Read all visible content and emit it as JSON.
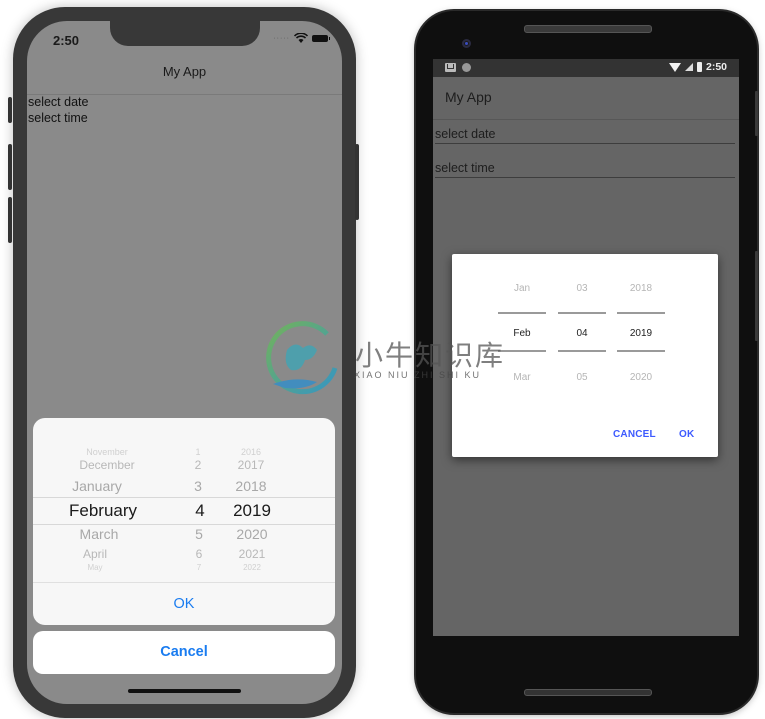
{
  "ios": {
    "status_time": "2:50",
    "status_dots": "·····",
    "nav_title": "My App",
    "fields": [
      "select date",
      "select time"
    ],
    "picker": {
      "months": [
        "November",
        "December",
        "January",
        "February",
        "March",
        "April",
        "May"
      ],
      "days": [
        "1",
        "2",
        "3",
        "4",
        "5",
        "6",
        "7"
      ],
      "years": [
        "2016",
        "2017",
        "2018",
        "2019",
        "2020",
        "2021",
        "2022"
      ],
      "selected": {
        "month": "February",
        "day": "4",
        "year": "2019"
      }
    },
    "ok_label": "OK",
    "cancel_label": "Cancel",
    "accent": "#1a7cf0"
  },
  "android": {
    "status_time": "2:50",
    "toolbar_title": "My App",
    "fields": [
      "select date",
      "select time"
    ],
    "picker": {
      "months": [
        "Jan",
        "Feb",
        "Mar"
      ],
      "days": [
        "03",
        "04",
        "05"
      ],
      "years": [
        "2018",
        "2019",
        "2020"
      ],
      "selected": {
        "month": "Feb",
        "day": "04",
        "year": "2019"
      }
    },
    "cancel_label": "CANCEL",
    "ok_label": "OK",
    "accent": "#3d5afe"
  },
  "watermark": {
    "chinese": "小牛知识库",
    "pinyin": "XIAO NIU ZHI SHI KU"
  }
}
